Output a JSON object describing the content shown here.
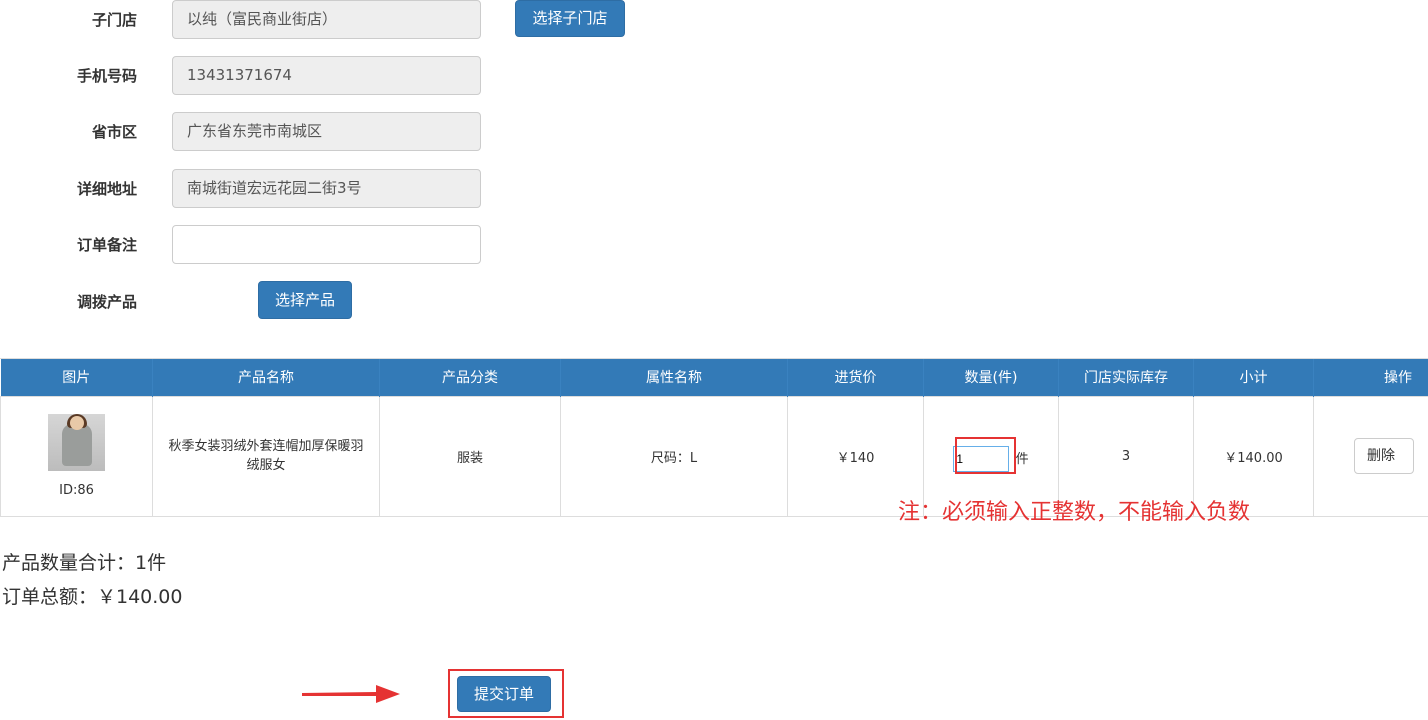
{
  "form": {
    "sub_store": {
      "label": "子门店",
      "value": "以纯（富民商业街店）",
      "button": "选择子门店"
    },
    "phone": {
      "label": "手机号码",
      "value": "13431371674"
    },
    "region": {
      "label": "省市区",
      "value": "广东省东莞市南城区"
    },
    "address": {
      "label": "详细地址",
      "value": "南城街道宏远花园二街3号"
    },
    "remark": {
      "label": "订单备注",
      "value": ""
    },
    "product": {
      "label": "调拨产品",
      "button": "选择产品"
    }
  },
  "table": {
    "headers": [
      "图片",
      "产品名称",
      "产品分类",
      "属性名称",
      "进货价",
      "数量(件)",
      "门店实际库存",
      "小计",
      "操作"
    ],
    "rows": [
      {
        "id_label": "ID:86",
        "name": "秋季女装羽绒外套连帽加厚保暖羽绒服女",
        "category": "服装",
        "attribute": "尺码：L",
        "price": "￥140",
        "quantity": "1",
        "unit": "件",
        "stock": "3",
        "subtotal": "￥140.00",
        "action": "删除"
      }
    ]
  },
  "note": "注：必须输入正整数，不能输入负数",
  "summary": {
    "total_qty": "产品数量合计：1件",
    "total_amount": "订单总额：￥140.00"
  },
  "submit_label": "提交订单",
  "colors": {
    "primary": "#337ab7",
    "annotation_red": "#e53333"
  }
}
